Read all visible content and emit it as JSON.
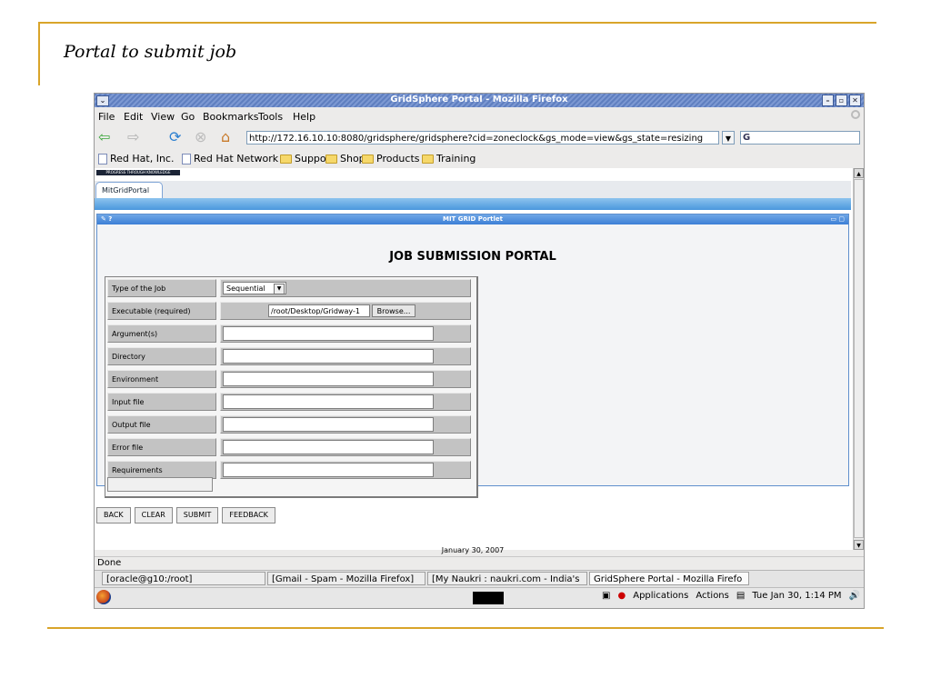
{
  "slide": {
    "title": "Portal to submit job"
  },
  "window": {
    "title": "GridSphere Portal - Mozilla Firefox",
    "sysmenu": "⌄",
    "buttons": [
      "–",
      "▫",
      "✕"
    ]
  },
  "menubar": [
    "File",
    "Edit",
    "View",
    "Go",
    "Bookmarks",
    "Tools",
    "Help"
  ],
  "navbar": {
    "url": "http://172.16.10.10:8080/gridsphere/gridsphere?cid=zoneclock&gs_mode=view&gs_state=resizing",
    "search_value": "G"
  },
  "bookmarks": [
    {
      "label": "Red Hat, Inc.",
      "icon": "page-icon"
    },
    {
      "label": "Red Hat Network",
      "icon": "page-icon"
    },
    {
      "label": "Support",
      "icon": "folder-icon"
    },
    {
      "label": "Shop",
      "icon": "folder-icon"
    },
    {
      "label": "Products",
      "icon": "folder-icon"
    },
    {
      "label": "Training",
      "icon": "folder-icon"
    }
  ],
  "portal": {
    "logo_text": "PROGRESS THROUGH KNOWLEDGE",
    "tab": "MitGridPortal",
    "portlet_title": "MIT GRID Portlet",
    "portlet_left": "✎ ?",
    "portlet_right": "▭ ▢",
    "heading": "JOB SUBMISSION PORTAL",
    "fields": [
      {
        "label": "Type of the Job",
        "kind": "select",
        "value": "Sequential"
      },
      {
        "label": "Executable (required)",
        "kind": "file",
        "value": "/root/Desktop/Gridway-1",
        "button": "Browse..."
      },
      {
        "label": "Argument(s)",
        "kind": "text",
        "value": ""
      },
      {
        "label": "Directory",
        "kind": "text",
        "value": ""
      },
      {
        "label": "Environment",
        "kind": "text",
        "value": ""
      },
      {
        "label": "Input file",
        "kind": "text",
        "value": ""
      },
      {
        "label": "Output file",
        "kind": "text",
        "value": ""
      },
      {
        "label": "Error file",
        "kind": "text",
        "value": ""
      },
      {
        "label": "Requirements",
        "kind": "text",
        "value": ""
      }
    ],
    "buttons": [
      "BACK",
      "CLEAR",
      "SUBMIT",
      "FEEDBACK"
    ],
    "footer_date": "January 30, 2007"
  },
  "status": "Done",
  "taskbar": [
    {
      "label": "[oracle@g10:/root]",
      "active": false
    },
    {
      "label": "[Gmail - Spam - Mozilla Firefox]",
      "active": false
    },
    {
      "label": "[My Naukri : naukri.com - India's",
      "active": false
    },
    {
      "label": "GridSphere Portal - Mozilla Firefo",
      "active": true
    }
  ],
  "panel": {
    "applications": "Applications",
    "actions": "Actions",
    "clock": "Tue Jan 30,  1:14 PM"
  }
}
